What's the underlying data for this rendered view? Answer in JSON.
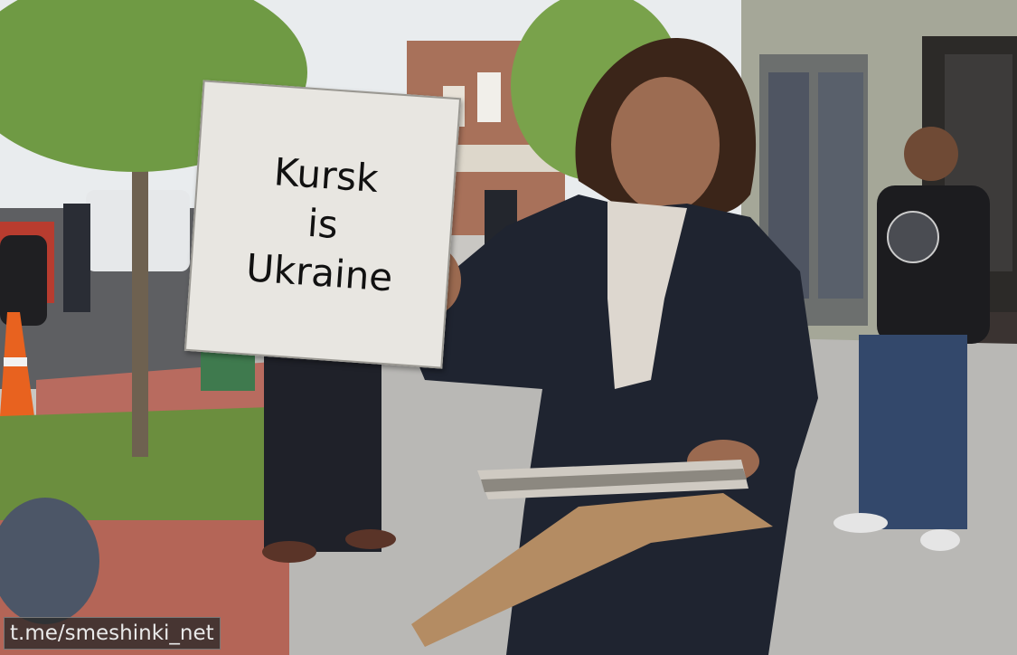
{
  "sign": {
    "line1": "Kursk",
    "line2": "is",
    "line3": "Ukraine"
  },
  "watermark": {
    "text": "t.me/smeshinki_net"
  },
  "colors": {
    "sky": "#e9ecee",
    "foliage": "#6f9a44",
    "building_brick": "#a8715a",
    "sidewalk": "#b9b8b5",
    "brick_path": "#b86b5f",
    "grass": "#6b8e3e",
    "blazer": "#1f2430",
    "blouse": "#ddd7cf",
    "envelope": "#b48c63",
    "sign_paper": "#e8e6e1"
  }
}
